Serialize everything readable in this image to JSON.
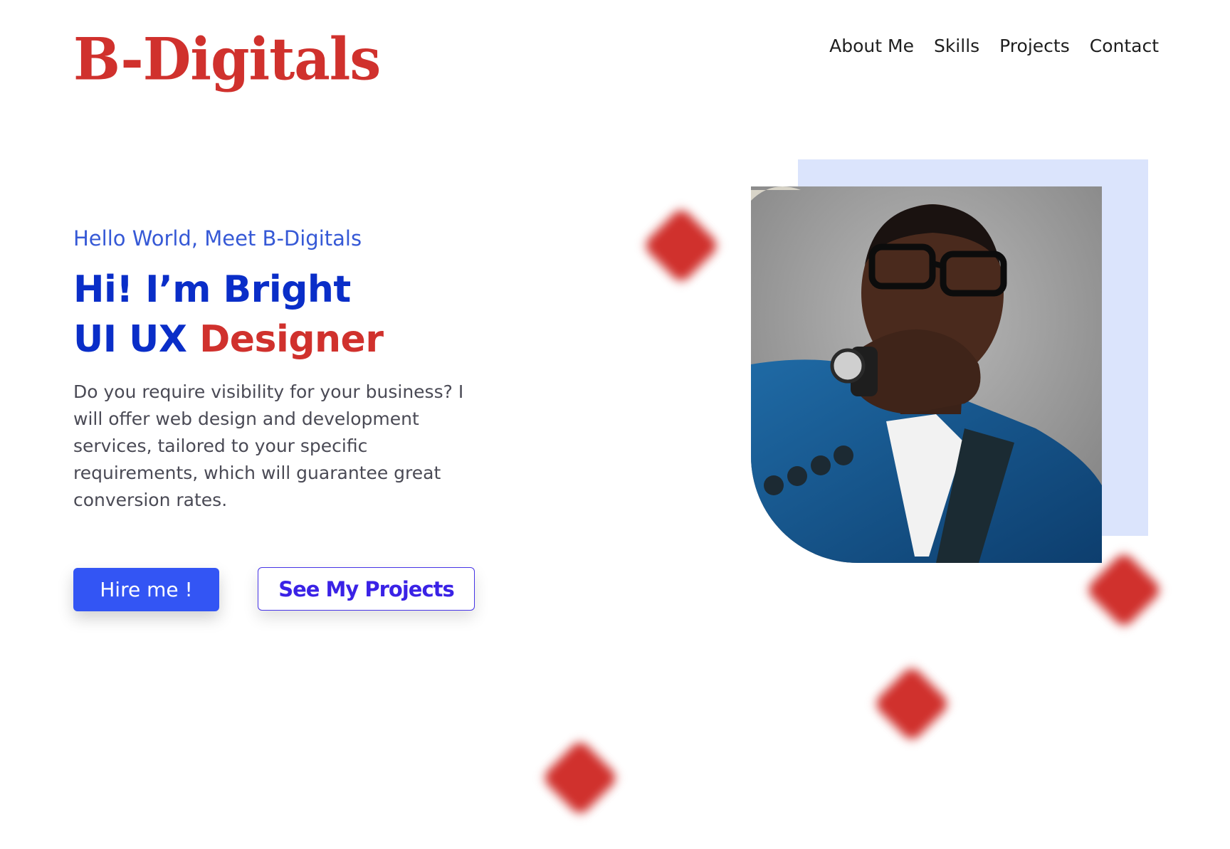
{
  "header": {
    "logo_text": "B-Digitals",
    "nav": [
      {
        "label": "About Me"
      },
      {
        "label": "Skills"
      },
      {
        "label": "Projects"
      },
      {
        "label": "Contact"
      }
    ]
  },
  "hero": {
    "greeting": "Hello World, Meet B-Digitals",
    "headline_line1": "Hi! I’m Bright",
    "headline_line2_part1": "UI UX ",
    "headline_line2_part2": "Designer",
    "intro": "Do you require visibility for your business? I will offer web design and development services, tailored to your specific requirements, which will guarantee great conversion rates.",
    "buttons": {
      "hire_label": "Hire me !",
      "projects_label": "See My Projects"
    }
  },
  "colors": {
    "brand_red": "#d0312d",
    "primary_blue": "#0a2ec8",
    "greeting_blue": "#3659d6",
    "button_blue": "#3355f4",
    "button_outline_purple": "#3a22e6",
    "portrait_backdrop": "#dbe4fc"
  },
  "icons": {
    "decorations": "blurred-red-diamond"
  }
}
